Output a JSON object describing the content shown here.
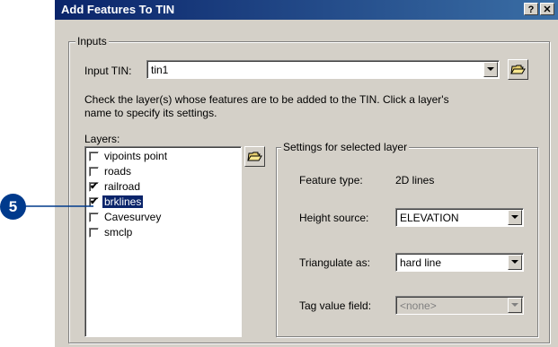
{
  "dialog": {
    "title": "Add Features To TIN",
    "help_button": "?",
    "close_button": "✕"
  },
  "inputs": {
    "group_label": "Inputs",
    "input_tin_label": "Input TIN:",
    "input_tin_value": "tin1",
    "instructions": [
      "Check the layer(s) whose features are to be added to the TIN. Click a layer's",
      "name to specify its settings."
    ],
    "layers_label": "Layers:"
  },
  "layers": [
    {
      "name": "vipoints point",
      "checked": false,
      "selected": false
    },
    {
      "name": "roads",
      "checked": false,
      "selected": false
    },
    {
      "name": "railroad",
      "checked": true,
      "selected": false
    },
    {
      "name": "brklines",
      "checked": true,
      "selected": true
    },
    {
      "name": "Cavesurvey",
      "checked": false,
      "selected": false
    },
    {
      "name": "smclp",
      "checked": false,
      "selected": false
    }
  ],
  "settings": {
    "group_label": "Settings for selected layer",
    "feature_type_label": "Feature type:",
    "feature_type_value": "2D lines",
    "height_source_label": "Height source:",
    "height_source_value": "ELEVATION",
    "triangulate_label": "Triangulate as:",
    "triangulate_value": "hard line",
    "tag_value_label": "Tag value field:",
    "tag_value_value": "<none>"
  },
  "callout": {
    "number": "5",
    "color": "#003a8c"
  },
  "icons": {
    "browse": "open-folder-icon",
    "check": "✔"
  }
}
